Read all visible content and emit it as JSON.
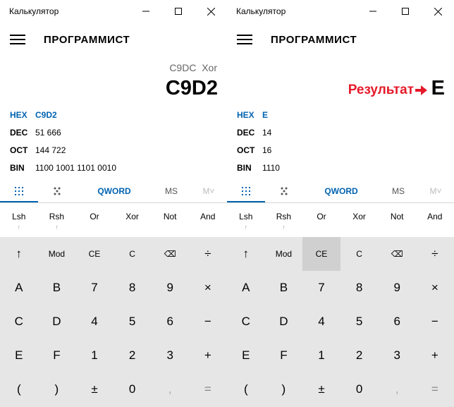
{
  "windows": [
    {
      "title": "Калькулятор",
      "mode": "ПРОГРАММИСТ",
      "expression": "C9DC  Xor",
      "result": "C9D2",
      "annotation": "",
      "radix": [
        {
          "label": "HEX",
          "value": "C9D2",
          "active": true
        },
        {
          "label": "DEC",
          "value": "51 666",
          "active": false
        },
        {
          "label": "OCT",
          "value": "144 722",
          "active": false
        },
        {
          "label": "BIN",
          "value": "1100 1001 1101 0010",
          "active": false
        }
      ],
      "word_size": "QWORD",
      "ms": "MS",
      "mdrop": "M˅",
      "highlight_key": ""
    },
    {
      "title": "Калькулятор",
      "mode": "ПРОГРАММИСТ",
      "expression": "",
      "result": "E",
      "annotation": "Результат",
      "radix": [
        {
          "label": "HEX",
          "value": "E",
          "active": true
        },
        {
          "label": "DEC",
          "value": "14",
          "active": false
        },
        {
          "label": "OCT",
          "value": "16",
          "active": false
        },
        {
          "label": "BIN",
          "value": "1110",
          "active": false
        }
      ],
      "word_size": "QWORD",
      "ms": "MS",
      "mdrop": "M˅",
      "highlight_key": "CE"
    }
  ],
  "bitops": [
    "Lsh",
    "Rsh",
    "Or",
    "Xor",
    "Not",
    "And"
  ],
  "bitop_sub": "↑",
  "keys": [
    [
      "↑",
      "Mod",
      "CE",
      "C",
      "⌫",
      "÷"
    ],
    [
      "A",
      "B",
      "7",
      "8",
      "9",
      "×"
    ],
    [
      "C",
      "D",
      "4",
      "5",
      "6",
      "−"
    ],
    [
      "E",
      "F",
      "1",
      "2",
      "3",
      "+"
    ],
    [
      "(",
      ")",
      "±",
      "0",
      ",",
      "="
    ]
  ],
  "icons": {
    "menu": "hamburger-icon",
    "minimize": "minimize-icon",
    "maximize": "maximize-icon",
    "close": "close-icon",
    "keypad_tab": "full-keypad-icon",
    "bit_tab": "bit-toggle-keypad-icon",
    "annotation_arrow": "red-arrow-icon"
  },
  "colors": {
    "accent": "#0063b1",
    "annotation": "#e51a2a",
    "keypad_bg": "#e6e6e6"
  }
}
